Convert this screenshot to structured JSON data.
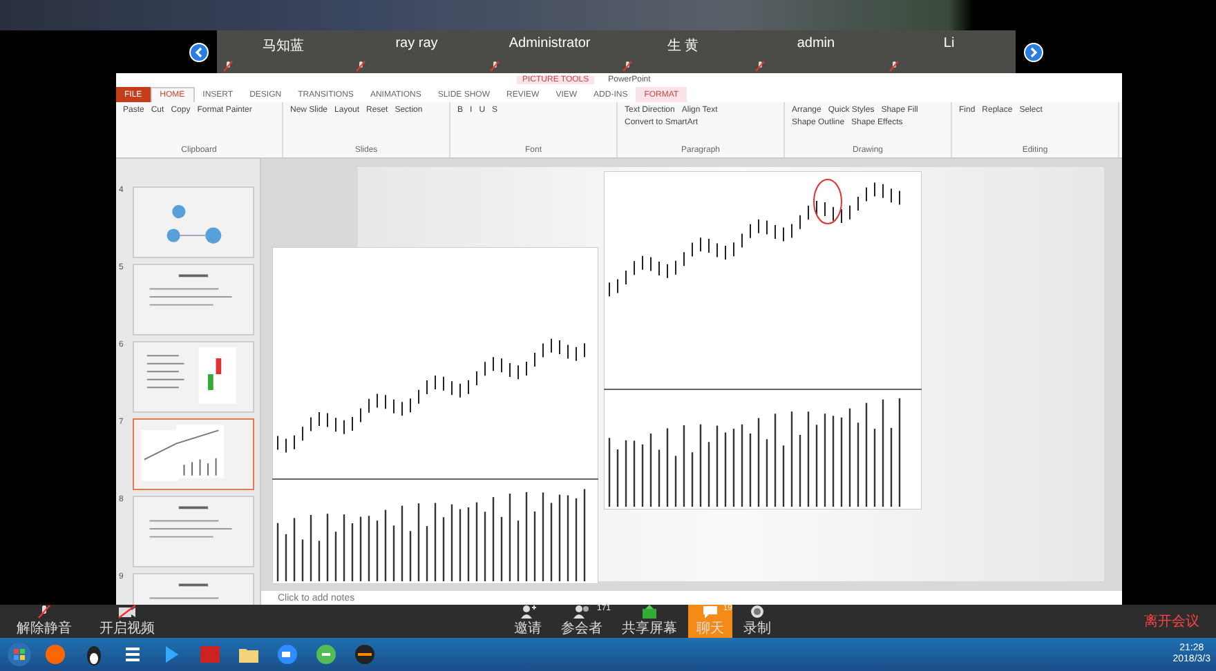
{
  "participants_strip": {
    "participants": [
      {
        "name": "马知蓝"
      },
      {
        "name": "ray ray"
      },
      {
        "name": "Administrator"
      },
      {
        "name": "生 黄"
      },
      {
        "name": "admin"
      },
      {
        "name": "Li"
      }
    ]
  },
  "powerpoint": {
    "contextual_group": "PICTURE TOOLS",
    "title": "PowerPoint",
    "tabs": [
      {
        "label": "FILE",
        "kind": "file",
        "selected": false
      },
      {
        "label": "HOME",
        "kind": "normal",
        "selected": true
      },
      {
        "label": "INSERT",
        "kind": "normal",
        "selected": false
      },
      {
        "label": "DESIGN",
        "kind": "normal",
        "selected": false
      },
      {
        "label": "TRANSITIONS",
        "kind": "normal",
        "selected": false
      },
      {
        "label": "ANIMATIONS",
        "kind": "normal",
        "selected": false
      },
      {
        "label": "SLIDE SHOW",
        "kind": "normal",
        "selected": false
      },
      {
        "label": "REVIEW",
        "kind": "normal",
        "selected": false
      },
      {
        "label": "VIEW",
        "kind": "normal",
        "selected": false
      },
      {
        "label": "ADD-INS",
        "kind": "normal",
        "selected": false
      },
      {
        "label": "FORMAT",
        "kind": "contextual",
        "selected": false
      }
    ],
    "ribbon_groups": [
      {
        "label": "Clipboard",
        "buttons": [
          "Paste",
          "Cut",
          "Copy",
          "Format Painter"
        ]
      },
      {
        "label": "Slides",
        "buttons": [
          "New Slide",
          "Layout",
          "Reset",
          "Section"
        ]
      },
      {
        "label": "Font",
        "buttons": [
          "B",
          "I",
          "U",
          "S"
        ]
      },
      {
        "label": "Paragraph",
        "buttons": [
          "Text Direction",
          "Align Text",
          "Convert to SmartArt"
        ]
      },
      {
        "label": "Drawing",
        "buttons": [
          "Arrange",
          "Quick Styles",
          "Shape Fill",
          "Shape Outline",
          "Shape Effects"
        ]
      },
      {
        "label": "Editing",
        "buttons": [
          "Find",
          "Replace",
          "Select"
        ]
      }
    ],
    "slide_thumbnails": [
      {
        "number": "4",
        "kind": "diagram",
        "selected": false
      },
      {
        "number": "5",
        "kind": "text",
        "selected": false
      },
      {
        "number": "6",
        "kind": "candles",
        "selected": false
      },
      {
        "number": "7",
        "kind": "chart",
        "selected": true
      },
      {
        "number": "8",
        "kind": "text",
        "selected": false
      },
      {
        "number": "9",
        "kind": "text",
        "selected": false
      }
    ],
    "notes_placeholder": "Click to add notes"
  },
  "meeting_toolbar": {
    "left": [
      {
        "label": "解除静音",
        "kind": "mic"
      },
      {
        "label": "开启视频",
        "kind": "camera"
      }
    ],
    "center": [
      {
        "label": "邀请",
        "kind": "invite",
        "selected": false
      },
      {
        "label": "参会者",
        "kind": "participants",
        "badge": "171",
        "selected": false
      },
      {
        "label": "共享屏幕",
        "kind": "share",
        "selected": false
      },
      {
        "label": "聊天",
        "kind": "chat",
        "badge": "19",
        "selected": true
      },
      {
        "label": "录制",
        "kind": "record",
        "selected": false
      }
    ],
    "leave": "离开会议"
  },
  "taskbar": {
    "time": "21:28",
    "date": "2018/3/3"
  }
}
